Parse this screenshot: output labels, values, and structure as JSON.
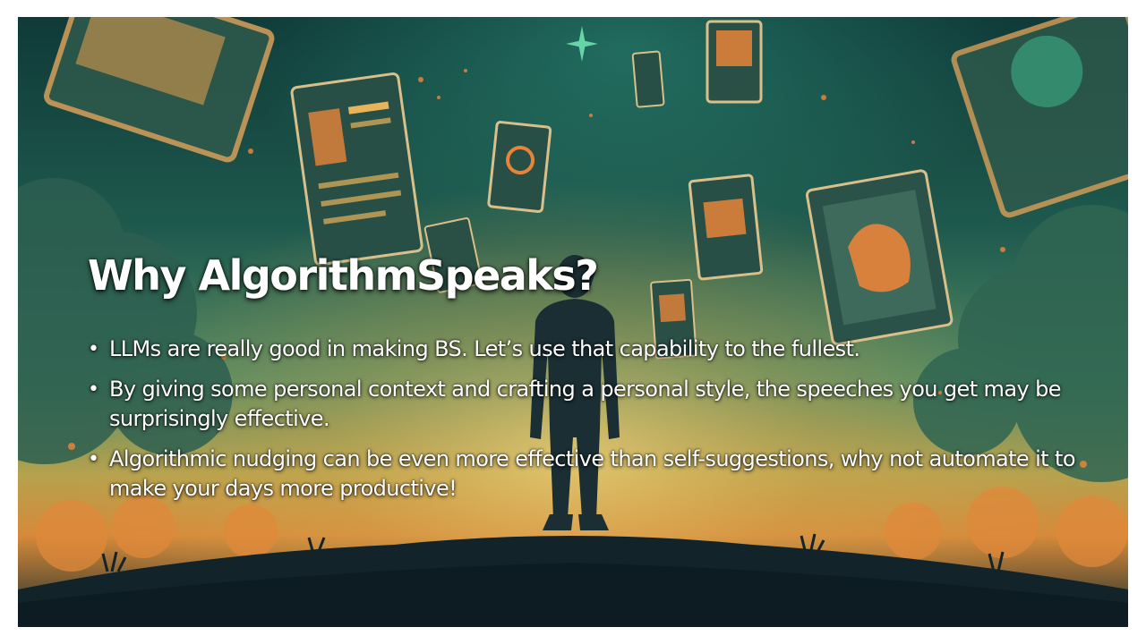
{
  "slide": {
    "title": "Why AlgorithmSpeaks?",
    "bullet_glyph": "•",
    "bullets": [
      "LLMs are really good in making BS. Let’s use that capability to the fullest.",
      "By giving some personal context and crafting a personal style, the speeches you get may be surprisingly effective.",
      "Algorithmic nudging can be even more effective than self-suggestions, why not automate it to make your days more productive!"
    ]
  },
  "theme": {
    "sky_top": "#0f3a38",
    "sky_mid": "#2f6f5e",
    "glow": "#e8b45a",
    "accent_orange": "#e8843a",
    "ground": "#12242a",
    "text": "#ffffff"
  },
  "background": {
    "scene": "person-silhouette-with-floating-screens"
  }
}
